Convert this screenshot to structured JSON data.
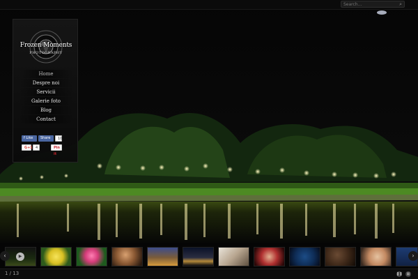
{
  "search": {
    "placeholder": "Search..."
  },
  "brand": {
    "title": "Frozen Moments",
    "subtitle": "PHOTOGRAPHY"
  },
  "nav": {
    "items": [
      {
        "label": "Home"
      },
      {
        "label": "Despre noi"
      },
      {
        "label": "Servicii"
      },
      {
        "label": "Galerie foto"
      },
      {
        "label": "Blog"
      },
      {
        "label": "Contact"
      }
    ]
  },
  "social": {
    "like_label": "Like",
    "share_label": "Share",
    "fb_count": "10",
    "gplus_label": "G+1",
    "gplus_count": "4",
    "pin_label": "Pin it"
  },
  "gallery": {
    "counter": "1 / 13",
    "thumbs": [
      "river night scene",
      "yellow flower",
      "pink lily",
      "portrait",
      "bridge at dusk",
      "river lights",
      "woman sitting",
      "red scarf portrait",
      "blue abstract",
      "coffee beans",
      "blonde portrait",
      "partial thumbnail"
    ]
  },
  "icons": {
    "search": "search-icon",
    "prev": "chevron-left-icon",
    "next": "chevron-right-icon",
    "play": "play-icon",
    "grid": "grid-icon"
  },
  "colors": {
    "facebook": "#4a66a0",
    "pinterest": "#c8232c",
    "gplus": "#d73d32"
  }
}
